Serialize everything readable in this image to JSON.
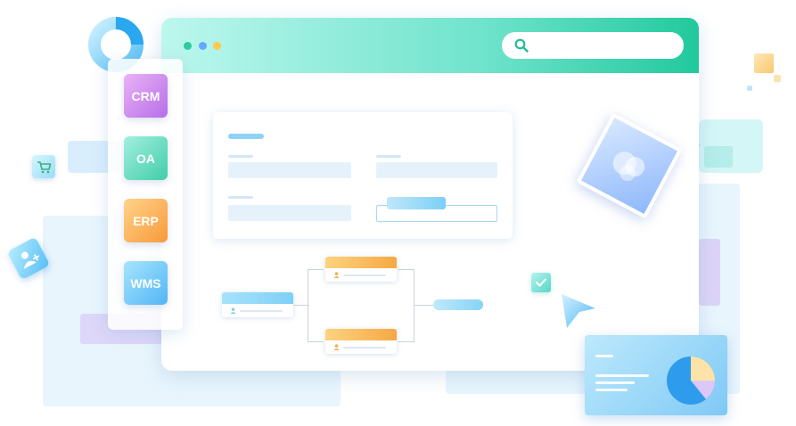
{
  "apps": [
    {
      "id": "crm",
      "label": "CRM"
    },
    {
      "id": "oa",
      "label": "OA"
    },
    {
      "id": "erp",
      "label": "ERP"
    },
    {
      "id": "wms",
      "label": "WMS"
    }
  ],
  "search": {
    "value": "",
    "placeholder": ""
  },
  "icons": {
    "search": "search-icon",
    "donut": "donut-chart-icon",
    "cart": "cart-icon",
    "user": "user-add-icon",
    "photo": "image-icon",
    "check": "check-icon",
    "cursor": "cursor-arrow-icon",
    "pie": "pie-chart-icon"
  },
  "colors": {
    "titlebar_end": "#22c99d",
    "crm": "#b76ee8",
    "oa": "#41cda9",
    "erp": "#f89a3a",
    "wms": "#52b5f6",
    "flow_blue": "#7fcff6",
    "flow_orange": "#f6a844"
  }
}
